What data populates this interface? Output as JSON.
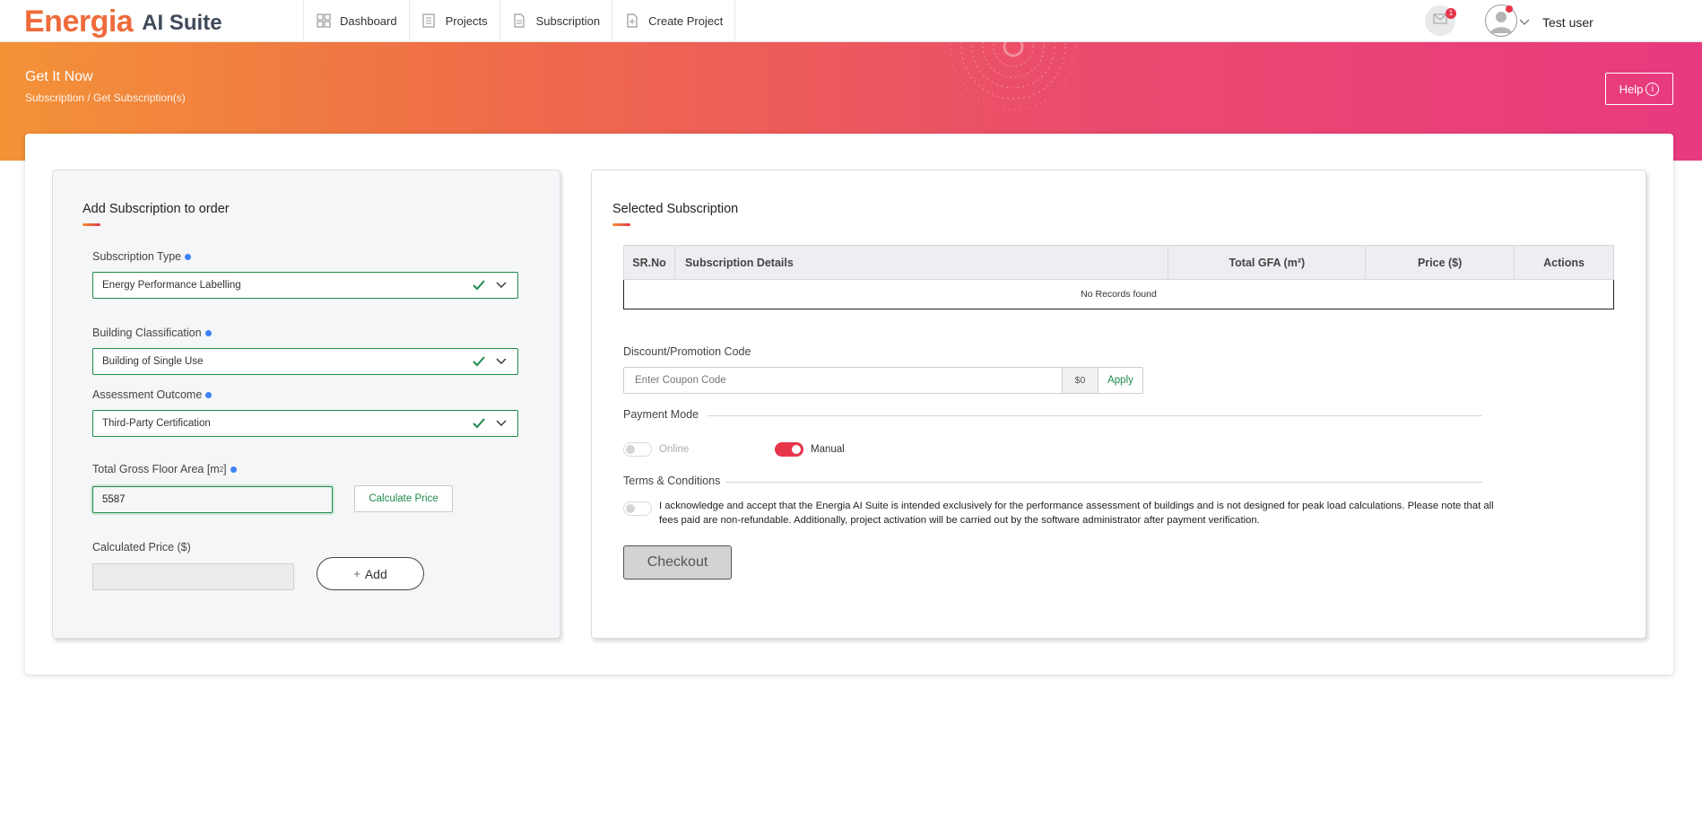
{
  "brand": {
    "name_part1": "Energia",
    "name_part2": "AI Suite",
    "accent": "#ef6b3b"
  },
  "nav": {
    "items": [
      {
        "label": "Dashboard",
        "icon": "dashboard-icon"
      },
      {
        "label": "Projects",
        "icon": "projects-icon"
      },
      {
        "label": "Subscription",
        "icon": "subscription-icon"
      },
      {
        "label": "Create Project",
        "icon": "create-project-icon"
      }
    ],
    "notification_count": "1",
    "user_name": "Test user"
  },
  "header": {
    "title": "Get It Now",
    "breadcrumb": "Subscription / Get Subscription(s)",
    "help_label": "Help"
  },
  "left": {
    "title": "Add Subscription to order",
    "subscription_type": {
      "label": "Subscription Type",
      "value": "Energy Performance Labelling"
    },
    "building_classification": {
      "label": "Building Classification",
      "value": "Building of Single Use"
    },
    "assessment_outcome": {
      "label": "Assessment Outcome",
      "value": "Third-Party Certification"
    },
    "gfa": {
      "label_prefix": "Total Gross Floor Area [m",
      "label_sup": "2",
      "label_suffix": "]",
      "value": "5587"
    },
    "calculate_label": "Calculate Price",
    "price": {
      "label": "Calculated Price ($)",
      "value": ""
    },
    "add_label": "Add"
  },
  "right": {
    "title": "Selected Subscription",
    "table": {
      "columns": [
        "SR.No",
        "Subscription Details",
        "Total GFA (m²)",
        "Price ($)",
        "Actions"
      ],
      "empty_text": "No Records found"
    },
    "discount": {
      "label": "Discount/Promotion Code",
      "placeholder": "Enter Coupon Code",
      "amount": "$0",
      "apply_label": "Apply"
    },
    "payment": {
      "label": "Payment Mode",
      "online_label": "Online",
      "manual_label": "Manual",
      "selected": "Manual"
    },
    "terms": {
      "label": "Terms & Conditions",
      "text": "I acknowledge and accept that the Energia AI Suite is intended exclusively for the performance assessment of buildings and is not designed for peak load calculations. Please note that all fees paid are non-refundable. Additionally, project activation will be carried out by the software administrator after payment verification.",
      "accepted": false
    },
    "checkout_label": "Checkout"
  },
  "colors": {
    "green": "#1e8a4a",
    "red": "#e8354a",
    "banner_start": "#f39237",
    "banner_end": "#e83a7f"
  }
}
